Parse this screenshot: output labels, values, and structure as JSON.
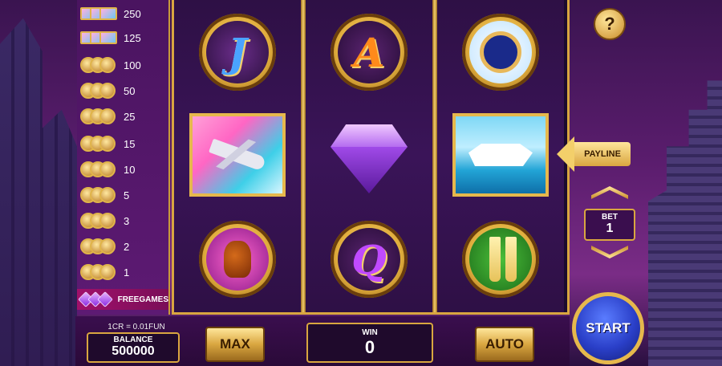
{
  "paytable": {
    "rows": [
      {
        "symbol": "jet-icon",
        "value": "250"
      },
      {
        "symbol": "yacht-icon",
        "value": "125"
      },
      {
        "symbol": "money-icon",
        "value": "100"
      },
      {
        "symbol": "watch-icon",
        "value": "50"
      },
      {
        "symbol": "cognac-icon",
        "value": "25"
      },
      {
        "symbol": "champagne-icon",
        "value": "15"
      },
      {
        "symbol": "coin-icon",
        "value": "10"
      },
      {
        "symbol": "letter-a-icon",
        "value": "5"
      },
      {
        "symbol": "letter-k-icon",
        "value": "3"
      },
      {
        "symbol": "letter-q-icon",
        "value": "2"
      },
      {
        "symbol": "letter-j-icon",
        "value": "1"
      },
      {
        "symbol": "diamond-icon",
        "value": "FREEGAMES"
      }
    ]
  },
  "reels": [
    [
      {
        "symbol": "letter-j",
        "glyph": "J",
        "style": "blue"
      },
      {
        "symbol": "private-jet",
        "glyph": "",
        "style": "jet"
      },
      {
        "symbol": "cognac",
        "glyph": "",
        "style": "cognac"
      }
    ],
    [
      {
        "symbol": "letter-a",
        "glyph": "A",
        "style": "orange"
      },
      {
        "symbol": "diamond",
        "glyph": "",
        "style": "diamond"
      },
      {
        "symbol": "letter-q",
        "glyph": "Q",
        "style": "purple"
      }
    ],
    [
      {
        "symbol": "watch",
        "glyph": "",
        "style": "watch"
      },
      {
        "symbol": "yacht",
        "glyph": "",
        "style": "yacht"
      },
      {
        "symbol": "champagne",
        "glyph": "",
        "style": "champagne"
      }
    ]
  ],
  "controls": {
    "help_label": "?",
    "payline_label": "PAYLINE",
    "bet_label": "BET",
    "bet_value": "1",
    "start_label": "START",
    "max_label": "MAX",
    "auto_label": "AUTO"
  },
  "status": {
    "rate": "1CR = 0.01FUN",
    "balance_label": "BALANCE",
    "balance_value": "500000",
    "win_label": "WIN",
    "win_value": "0"
  },
  "colors": {
    "gold": "#d9a640",
    "background": "#5b1d6e",
    "start_button": "#2a3fc8"
  }
}
